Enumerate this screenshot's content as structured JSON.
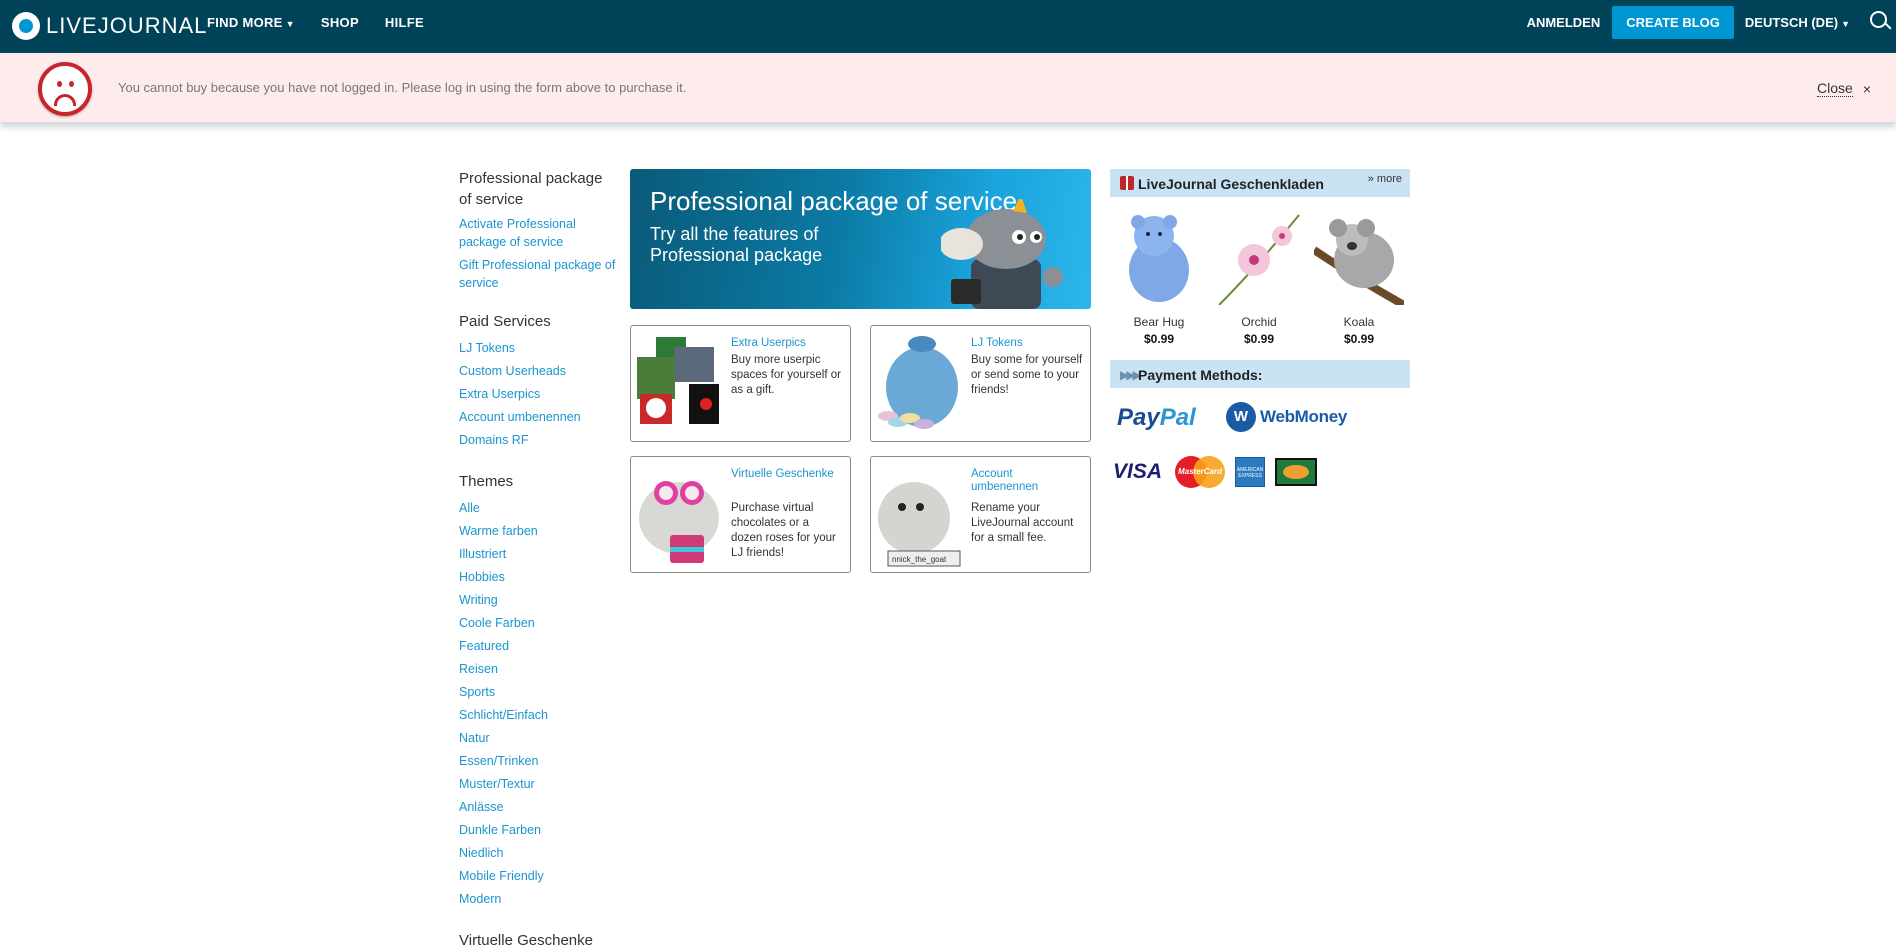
{
  "header": {
    "logo_text": "LIVEJOURNAL",
    "nav": [
      "FIND MORE",
      "SHOP",
      "HILFE"
    ],
    "login": "ANMELDEN",
    "create_blog": "CREATE BLOG",
    "language": "DEUTSCH (DE)"
  },
  "alert": {
    "message": "You cannot buy because you have not logged in. Please log in using the form above to purchase it.",
    "close": "Close",
    "close_x": "×"
  },
  "sidebar": {
    "sections": [
      {
        "heading": "Professional package of service",
        "links": [
          "Activate Professional package of service",
          "Gift Professional package of service"
        ]
      },
      {
        "heading": "Paid Services",
        "links": [
          "LJ Tokens",
          "Custom Userheads",
          "Extra Userpics",
          "Account umbenennen",
          "Domains RF"
        ]
      },
      {
        "heading": "Themes",
        "links": [
          "Alle",
          "Warme farben",
          "Illustriert",
          "Hobbies",
          "Writing",
          "Coole Farben",
          "Featured",
          "Reisen",
          "Sports",
          "Schlicht/Einfach",
          "Natur",
          "Essen/Trinken",
          "Muster/Textur",
          "Anlässe",
          "Dunkle Farben",
          "Niedlich",
          "Mobile Friendly",
          "Modern"
        ]
      },
      {
        "heading": "Virtuelle Geschenke",
        "links": []
      }
    ]
  },
  "banner": {
    "title": "Professional package of service",
    "subtitle": "Try all the features of Professional package"
  },
  "cards": [
    {
      "title": "Extra Userpics",
      "desc": "Buy more userpic spaces for yourself or as a gift."
    },
    {
      "title": "LJ Tokens",
      "desc": "Buy some for yourself or send some to your friends!"
    },
    {
      "title": "Virtuelle Geschenke",
      "desc": "Purchase virtual chocolates or a dozen roses for your LJ friends!"
    },
    {
      "title": "Account umbenennen",
      "desc": "Rename your LiveJournal account for a small fee.",
      "img_caption": "nnick_the_goat"
    }
  ],
  "shop": {
    "title": "LiveJournal Geschenkladen",
    "more": "» more",
    "items": [
      {
        "name": "Bear Hug",
        "price": "$0.99"
      },
      {
        "name": "Orchid",
        "price": "$0.99"
      },
      {
        "name": "Koala",
        "price": "$0.99"
      }
    ]
  },
  "payment": {
    "title": "Payment Methods:",
    "paypal_a": "Pay",
    "paypal_b": "Pal",
    "webmoney": "WebMoney",
    "visa": "VISA",
    "mastercard": "MasterCard",
    "amex": "AMERICAN EXPRESS"
  }
}
